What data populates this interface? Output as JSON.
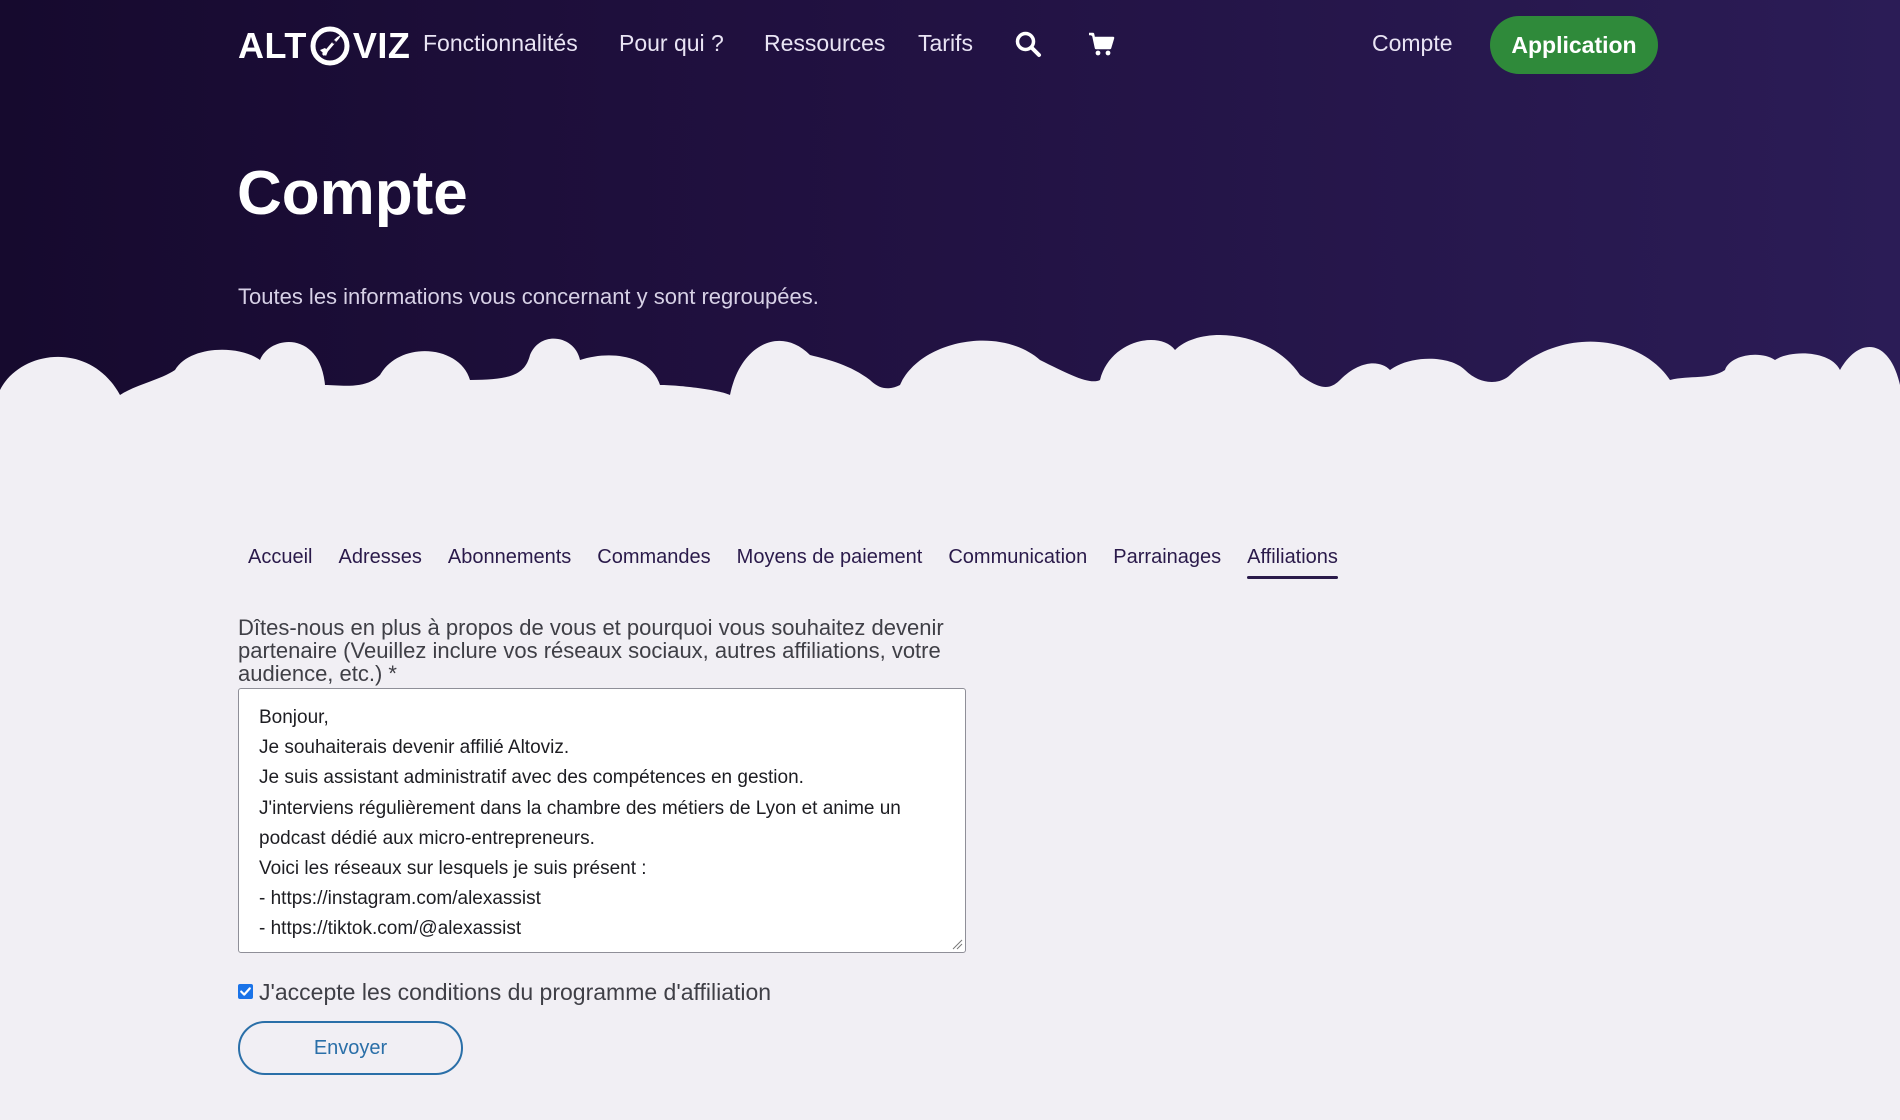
{
  "nav": {
    "logo_left": "ALT",
    "logo_right": "VIZ",
    "items": [
      "Fonctionnalités",
      "Pour qui ?",
      "Ressources",
      "Tarifs"
    ],
    "account": "Compte",
    "app_button": "Application",
    "icons": [
      "search-icon",
      "cart-icon"
    ]
  },
  "hero": {
    "title": "Compte",
    "subtitle": "Toutes les informations vous concernant y sont regroupées."
  },
  "tabs": [
    {
      "label": "Accueil",
      "active": false
    },
    {
      "label": "Adresses",
      "active": false
    },
    {
      "label": "Abonnements",
      "active": false
    },
    {
      "label": "Commandes",
      "active": false
    },
    {
      "label": "Moyens de paiement",
      "active": false
    },
    {
      "label": "Communication",
      "active": false
    },
    {
      "label": "Parrainages",
      "active": false
    },
    {
      "label": "Affiliations",
      "active": true
    }
  ],
  "form": {
    "label": "Dîtes-nous en plus à propos de vous et pourquoi vous souhaitez devenir partenaire (Veuillez inclure vos réseaux sociaux, autres affiliations, votre audience, etc.) *",
    "message_lines": [
      "Bonjour,",
      "Je souhaiterais devenir affilié Altoviz.",
      "Je suis assistant administratif avec des compétences en gestion.",
      "J'interviens régulièrement dans la chambre des métiers de Lyon et anime un podcast dédié aux micro-entrepreneurs.",
      "Voici les réseaux sur lesquels je suis présent :",
      "- https://instagram.com/alexassist",
      "- https://tiktok.com/@alexassist"
    ],
    "accept_label": "J'accepte les conditions du programme d'affiliation",
    "accept_checked": true,
    "submit_label": "Envoyer"
  },
  "colors": {
    "hero_dark": "#160a2e",
    "hero_light": "#2b1c56",
    "app_button": "#2f8a3a",
    "background": "#f1eff4",
    "link_blue": "#2a6fa8"
  }
}
